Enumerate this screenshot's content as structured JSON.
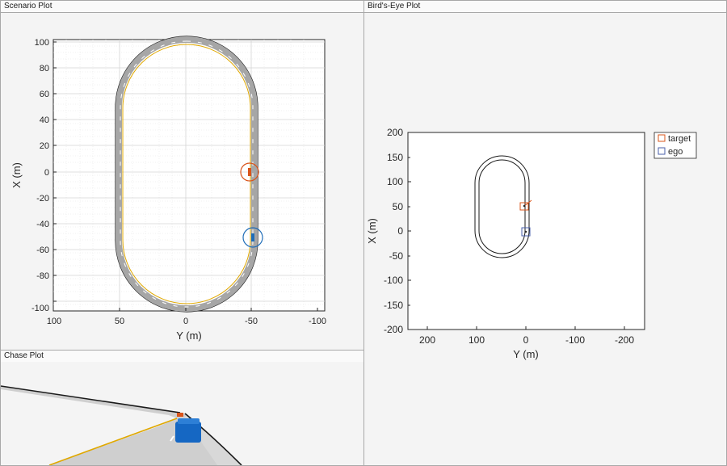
{
  "scenario": {
    "title": "Scenario Plot",
    "x_ticks": [
      "100",
      "50",
      "0",
      "-50",
      "-100"
    ],
    "y_ticks": [
      "100",
      "80",
      "60",
      "40",
      "20",
      "0",
      "-20",
      "-40",
      "-60",
      "-80",
      "-100"
    ],
    "xlabel": "Y (m)",
    "ylabel": "X (m)",
    "colors": {
      "road": "#9a9a9a",
      "edge": "#1a1a1a",
      "lane_line": "#e0a800",
      "target": "#d9541a",
      "ego": "#1f6db8"
    }
  },
  "chase": {
    "title": "Chase Plot",
    "colors": {
      "road": "#c8c8c8",
      "ego": "#1567c3",
      "target": "#d9541a",
      "lane_line": "#e0a800"
    }
  },
  "birdseye": {
    "title": "Bird's-Eye Plot",
    "x_ticks": [
      "200",
      "100",
      "0",
      "-100",
      "-200"
    ],
    "y_ticks": [
      "200",
      "150",
      "100",
      "50",
      "0",
      "-50",
      "-100",
      "-150",
      "-200"
    ],
    "xlabel": "Y (m)",
    "ylabel": "X (m)",
    "legend": [
      {
        "label": "target",
        "color": "#d9541a"
      },
      {
        "label": "ego",
        "color": "#4a5fa8"
      }
    ]
  }
}
